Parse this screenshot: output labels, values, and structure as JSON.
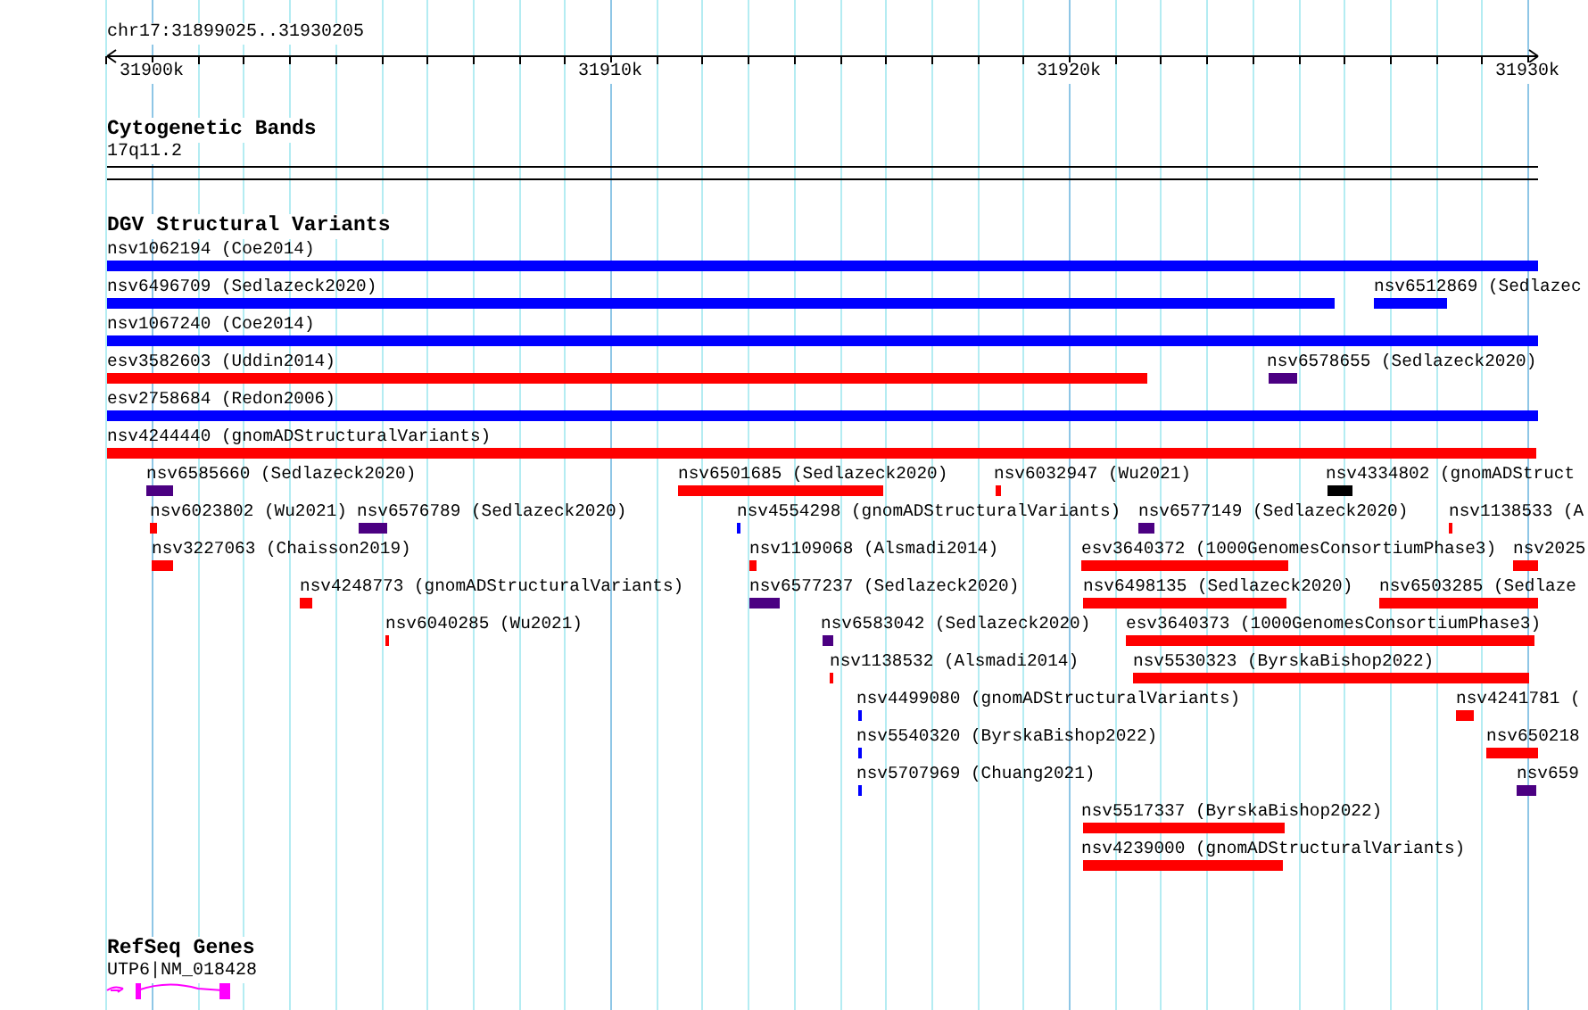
{
  "ruler": {
    "location": "chr17:31899025..31930205",
    "ticks": [
      "31900k",
      "31910k",
      "31920k",
      "31930k"
    ]
  },
  "tracks": [
    {
      "kind": "cytoband",
      "title": "Cytogenetic Bands",
      "features": [
        {
          "label": "17q11.2"
        }
      ]
    },
    {
      "kind": "variants",
      "title": "DGV Structural Variants",
      "features": [
        {
          "label": "nsv1062194 (Coe2014)",
          "color": "#0000ff"
        },
        {
          "label": "nsv6496709 (Sedlazeck2020)",
          "color": "#0000ff"
        },
        {
          "label": "nsv6512869 (Sedlazec",
          "color": "#0000ff"
        },
        {
          "label": "nsv1067240 (Coe2014)",
          "color": "#0000ff"
        },
        {
          "label": "esv3582603 (Uddin2014)",
          "color": "#ff0000"
        },
        {
          "label": "nsv6578655 (Sedlazeck2020)",
          "color": "#4b0082"
        },
        {
          "label": "esv2758684 (Redon2006)",
          "color": "#0000ff"
        },
        {
          "label": "nsv4244440 (gnomADStructuralVariants)",
          "color": "#ff0000"
        },
        {
          "label": "nsv6585660 (Sedlazeck2020)",
          "color": "#4b0082"
        },
        {
          "label": "nsv6501685 (Sedlazeck2020)",
          "color": "#ff0000"
        },
        {
          "label": "nsv6032947 (Wu2021)",
          "color": "#ff0000"
        },
        {
          "label": "nsv4334802 (gnomADStruct",
          "color": "#000000"
        },
        {
          "label": "nsv6023802 (Wu2021)",
          "color": "#ff0000"
        },
        {
          "label": "nsv6576789 (Sedlazeck2020)",
          "color": "#4b0082"
        },
        {
          "label": "nsv4554298 (gnomADStructuralVariants)",
          "color": "#0000ff"
        },
        {
          "label": "nsv6577149 (Sedlazeck2020)",
          "color": "#4b0082"
        },
        {
          "label": "nsv1138533 (A",
          "color": "#ff0000"
        },
        {
          "label": "nsv3227063 (Chaisson2019)",
          "color": "#ff0000"
        },
        {
          "label": "nsv1109068 (Alsmadi2014)",
          "color": "#ff0000"
        },
        {
          "label": "esv3640372 (1000GenomesConsortiumPhase3)",
          "color": "#ff0000"
        },
        {
          "label": "nsv2025",
          "color": "#ff0000"
        },
        {
          "label": "nsv4248773 (gnomADStructuralVariants)",
          "color": "#ff0000"
        },
        {
          "label": "nsv6577237 (Sedlazeck2020)",
          "color": "#4b0082"
        },
        {
          "label": "nsv6498135 (Sedlazeck2020)",
          "color": "#ff0000"
        },
        {
          "label": "nsv6503285 (Sedlaze",
          "color": "#ff0000"
        },
        {
          "label": "nsv6040285 (Wu2021)",
          "color": "#ff0000"
        },
        {
          "label": "nsv6583042 (Sedlazeck2020)",
          "color": "#4b0082"
        },
        {
          "label": "esv3640373 (1000GenomesConsortiumPhase3)",
          "color": "#ff0000"
        },
        {
          "label": "nsv1138532 (Alsmadi2014)",
          "color": "#ff0000"
        },
        {
          "label": "nsv5530323 (ByrskaBishop2022)",
          "color": "#ff0000"
        },
        {
          "label": "nsv4499080 (gnomADStructuralVariants)",
          "color": "#0000ff"
        },
        {
          "label": "nsv4241781 (",
          "color": "#ff0000"
        },
        {
          "label": "nsv5540320 (ByrskaBishop2022)",
          "color": "#0000ff"
        },
        {
          "label": "nsv650218",
          "color": "#ff0000"
        },
        {
          "label": "nsv5707969 (Chuang2021)",
          "color": "#0000ff"
        },
        {
          "label": "nsv659",
          "color": "#4b0082"
        },
        {
          "label": "nsv5517337 (ByrskaBishop2022)",
          "color": "#ff0000"
        },
        {
          "label": "nsv4239000 (gnomADStructuralVariants)",
          "color": "#ff0000"
        }
      ]
    },
    {
      "kind": "genes",
      "title": "RefSeq Genes",
      "features": [
        {
          "label": "UTP6|NM_018428",
          "color": "#ff00ff"
        }
      ]
    }
  ]
}
